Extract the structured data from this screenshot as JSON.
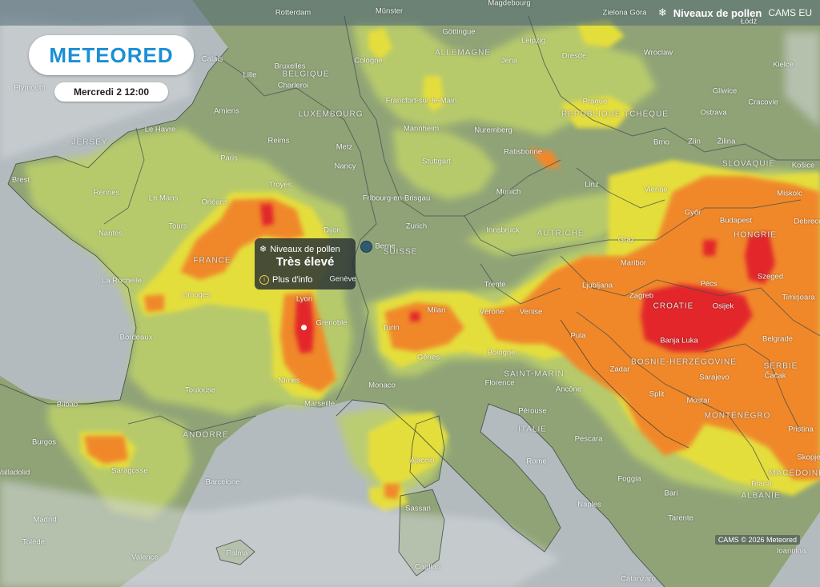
{
  "header": {
    "layer_title": "Niveaux de pollen",
    "source": "CAMS EU"
  },
  "brand": {
    "logo_text": "METEORED",
    "datetime": "Mercredi 2 12:00"
  },
  "popup": {
    "title": "Niveaux de pollen",
    "level": "Très élevé",
    "more_label": "Plus d'info"
  },
  "credit": "CAMS © 2026 Meteored",
  "icons": {
    "pollen": "pollen-icon",
    "info": "info-icon"
  },
  "colors": {
    "land": "#8fa377",
    "sea": "#b3bbbf",
    "low": "#bccf6a",
    "moderate": "#e4de3c",
    "high": "#f0882a",
    "very_high": "#e2262a",
    "logo": "#1b8fd6"
  },
  "cities": [
    "Rotterdam",
    "Münster",
    "Magdebourg",
    "Zielona Góra",
    "Łódź",
    "Göttingue",
    "Leipzig",
    "Cologne",
    "Calais",
    "Bruxelles",
    "Lille",
    "Charleroi",
    "Jena",
    "Dresde",
    "Wroclaw",
    "Kielce",
    "Plymouth",
    "Francfort-sur-le-Main",
    "Prague",
    "Gliwice",
    "Cracovie",
    "Amiens",
    "Le Havre",
    "Mannheim",
    "Nuremberg",
    "Ostrava",
    "Brno",
    "Zlín",
    "Žilina",
    "Košice",
    "Reims",
    "Metz",
    "Paris",
    "Nancy",
    "Stuttgart",
    "Ratisbonne",
    "Brest",
    "Rennes",
    "Le Mans",
    "Orléans",
    "Troyes",
    "Fribourg-en-Brisgau",
    "Munich",
    "Linz",
    "Vienne",
    "Miskolc",
    "Tours",
    "Dijon",
    "Zurich",
    "Innsbruck",
    "Győr",
    "Budapest",
    "Debrecen",
    "Nantes",
    "Berne",
    "Graz",
    "Maribor",
    "Pécs",
    "Szeged",
    "La Rochelle",
    "Limoges",
    "Genève",
    "Ljubljana",
    "Zagreb",
    "Osijek",
    "Timișoara",
    "Lyon",
    "Milan",
    "Vérone",
    "Venise",
    "Trente",
    "Bordeaux",
    "Grenoble",
    "Turin",
    "Pula",
    "Banja Luka",
    "Belgrade",
    "Gênes",
    "Bologne",
    "Zadar",
    "Sarajevo",
    "Čačak",
    "Nîmes",
    "Toulouse",
    "Monaco",
    "Florence",
    "Ancône",
    "Split",
    "Mostar",
    "Marseille",
    "Bilbao",
    "Pérouse",
    "Pristina",
    "Burgos",
    "Ajaccio",
    "Pescara",
    "Rome",
    "Skopje",
    "Saragosse",
    "Barcelone",
    "Foggia",
    "Tirana",
    "Sassari",
    "Naples",
    "Bari",
    "Madrid",
    "Tarente",
    "Tolède",
    "Palma",
    "Valence",
    "Cagliari",
    "Catanzaro",
    "Ioannina",
    "Valladolid"
  ],
  "countries": [
    "ALLEMAGNE",
    "BELGIQUE",
    "LUXEMBOURG",
    "RÉPUBLIQUE TCHÈQUE",
    "SLOVAQUIE",
    "FRANCE",
    "SUISSE",
    "AUTRICHE",
    "HONGRIE",
    "CROATIE",
    "BOSNIE-HERZÉGOVINE",
    "SERBIE",
    "MONTÉNÉGRO",
    "ANDORRE",
    "ITALIE",
    "SAINT-MARIN",
    "MACÉDOINE",
    "ALBANIE",
    "JERSEY"
  ]
}
